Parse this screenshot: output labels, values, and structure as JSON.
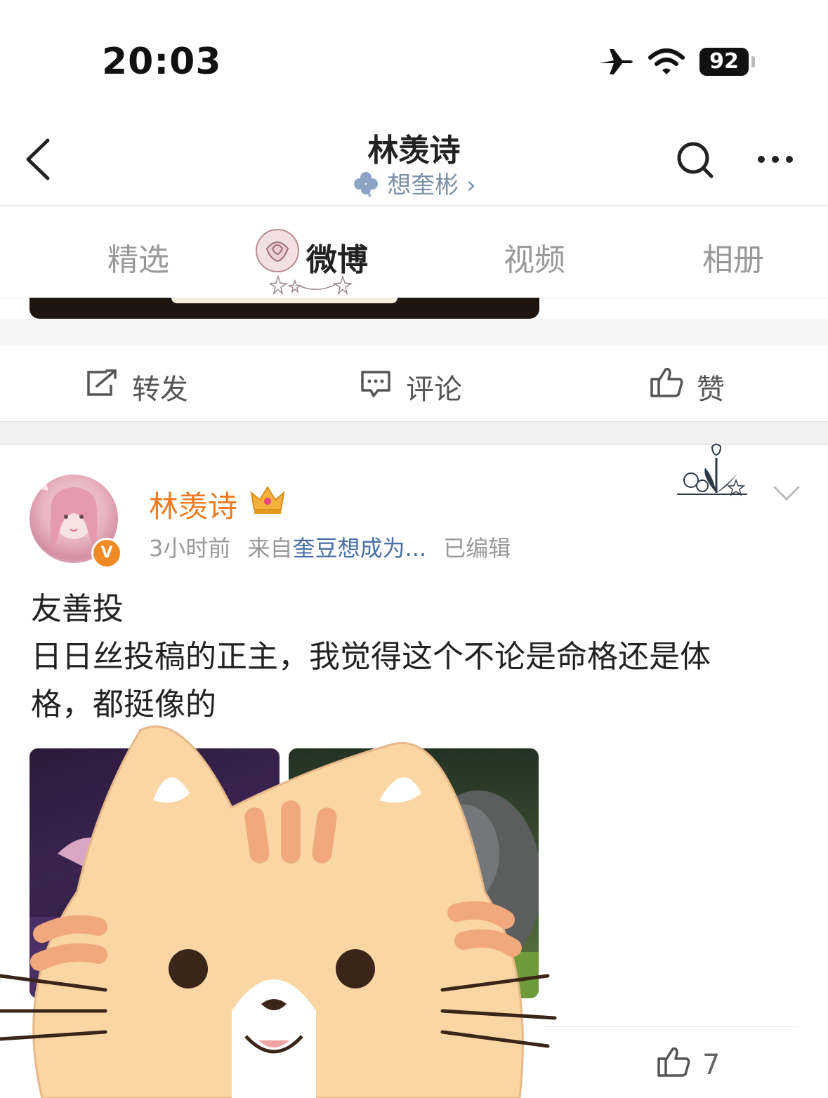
{
  "status_bar": {
    "time": "20:03",
    "battery": "92"
  },
  "header": {
    "title": "林羡诗",
    "subtitle": "想奎彬",
    "subtitle_chevron": "›"
  },
  "tabs": [
    {
      "label": "精选",
      "active": false
    },
    {
      "label": "微博",
      "active": true
    },
    {
      "label": "视频",
      "active": false
    },
    {
      "label": "相册",
      "active": false
    }
  ],
  "prev_actions": {
    "repost": "转发",
    "comment": "评论",
    "like": "赞"
  },
  "post": {
    "author": "林羡诗",
    "verified_badge": "V",
    "time": "3小时前",
    "source_prefix": "来自",
    "source": "奎豆想成为...",
    "edited": "已编辑",
    "text_lines": [
      "友善投",
      "日日丝投稿的正主，我觉得这个不论是命格还是体",
      "格，都挺像的"
    ],
    "like_count": "7"
  },
  "colors": {
    "author_orange": "#f07a20",
    "source_blue": "#4a6fa5",
    "verified": "#f08a24"
  }
}
